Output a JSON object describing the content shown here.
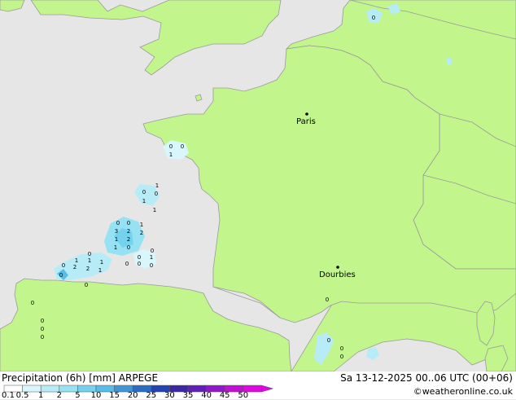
{
  "map": {
    "cities": [
      {
        "name": "Paris"
      },
      {
        "name": "Dourbies"
      }
    ],
    "precip_labels": [
      "0",
      "0",
      "1",
      "1",
      "0",
      "0",
      "1",
      "1",
      "0",
      "0",
      "1",
      "3",
      "2",
      "2",
      "1",
      "2",
      "1",
      "0",
      "0",
      "0",
      "0",
      "1",
      "1",
      "1",
      "1",
      "0",
      "0",
      "0",
      "2",
      "2",
      "1",
      "0",
      "0",
      "0",
      "0",
      "0",
      "0",
      "0",
      "0",
      "0",
      "0",
      "0",
      "0"
    ]
  },
  "footer": {
    "title": "Precipitation (6h) [mm] ARPEGE",
    "datetime": "Sa 13-12-2025 00..06 UTC (00+06)",
    "credit": "©weatheronline.co.uk",
    "scale_labels": [
      "0.1",
      "0.5",
      "1",
      "2",
      "5",
      "10",
      "15",
      "20",
      "25",
      "30",
      "35",
      "40",
      "45",
      "50"
    ],
    "scale_colors": [
      "#fefefe",
      "#d8f6fb",
      "#b7ecf7",
      "#96e2f3",
      "#75d2ee",
      "#56bde6",
      "#3f96d6",
      "#2b6dc4",
      "#2243b0",
      "#3a28a4",
      "#6020b6",
      "#9018c6",
      "#c010d4",
      "#e008e0"
    ]
  }
}
